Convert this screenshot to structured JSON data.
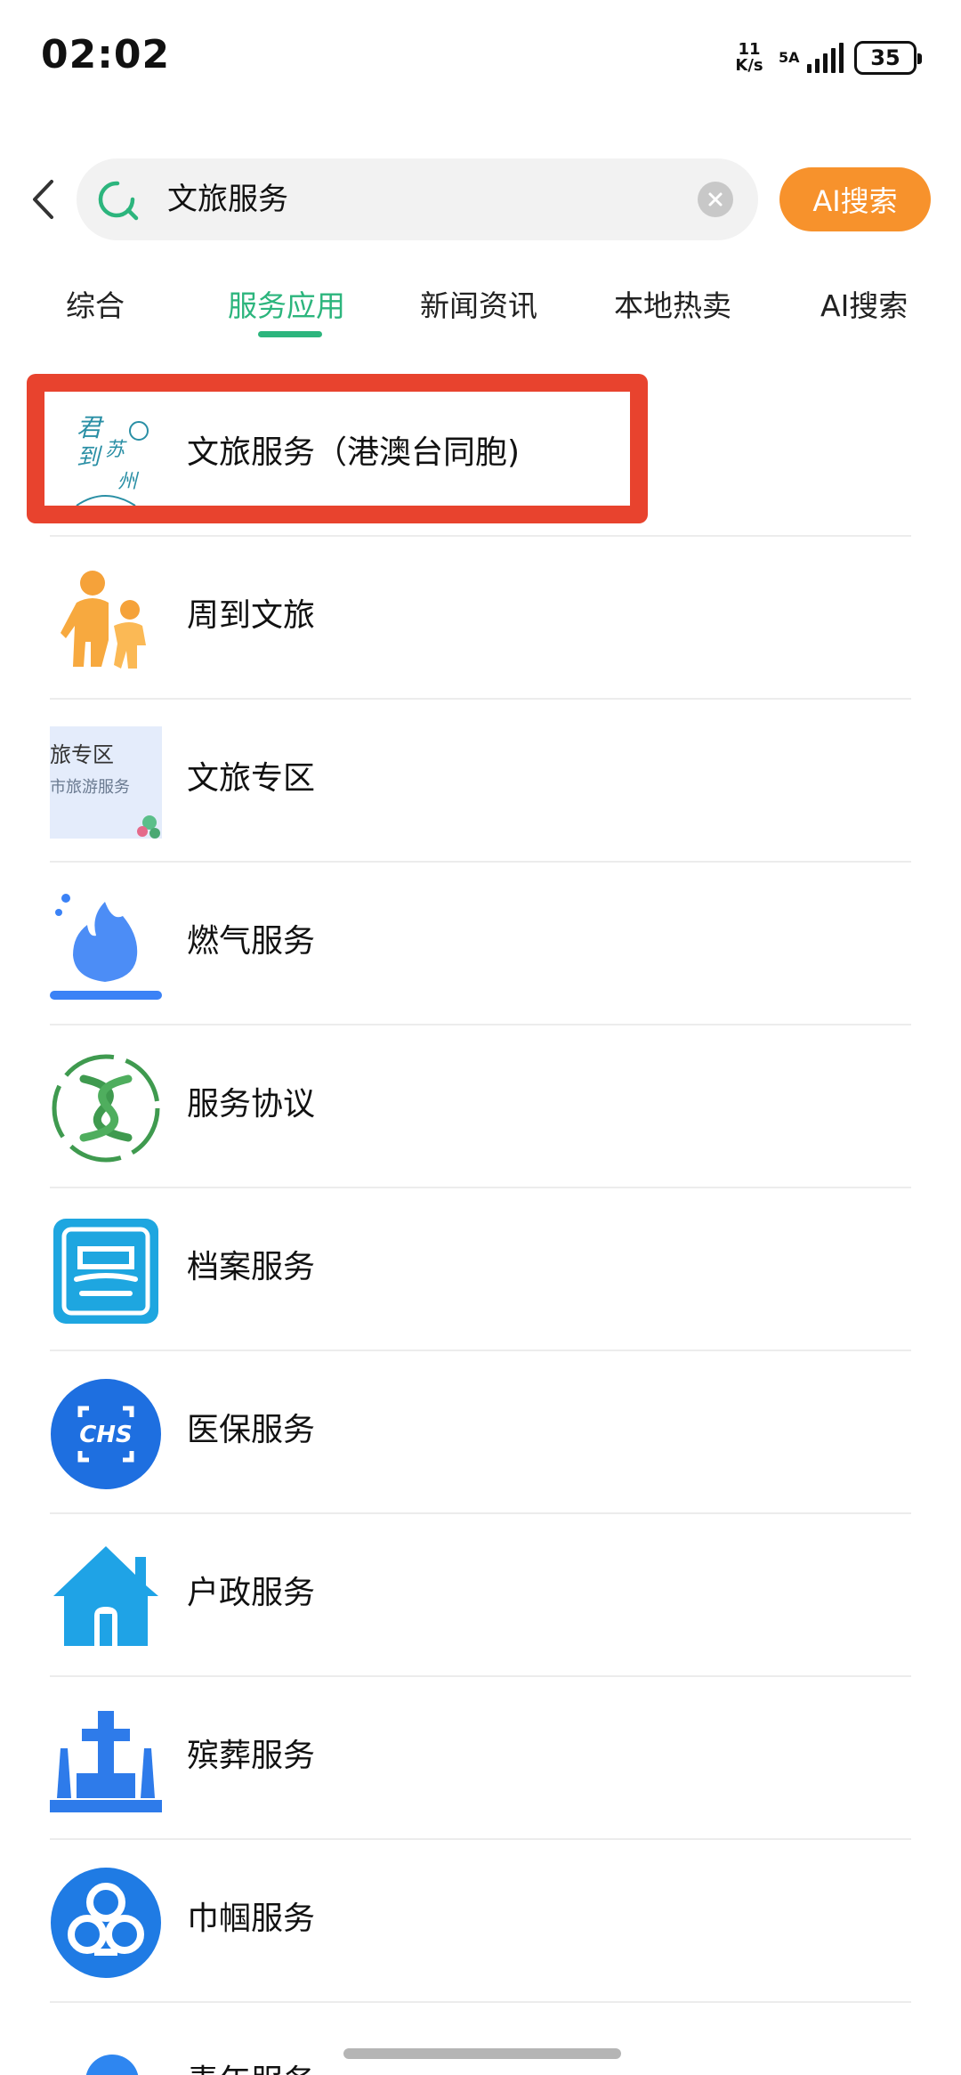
{
  "status_bar": {
    "time": "02:02",
    "net_speed_value": "11",
    "net_speed_unit": "K/s",
    "signal_label": "5A",
    "battery": "35"
  },
  "search": {
    "query": "文旅服务",
    "ai_button": "AI搜索"
  },
  "tabs": [
    {
      "label": "综合"
    },
    {
      "label": "服务应用",
      "active": true
    },
    {
      "label": "新闻资讯"
    },
    {
      "label": "本地热卖"
    },
    {
      "label": "AI搜索"
    }
  ],
  "results": [
    {
      "label": "文旅服务（港澳台同胞)",
      "icon": "calligraphy-logo-icon",
      "thumb_text": [
        "君",
        "到",
        "苏",
        "州"
      ]
    },
    {
      "label": "周到文旅",
      "icon": "parent-child-icon"
    },
    {
      "label": "文旅专区",
      "icon": "tourism-banner-icon",
      "thumb_text": [
        "旅专区",
        "市旅游服务"
      ]
    },
    {
      "label": "燃气服务",
      "icon": "gas-flame-icon"
    },
    {
      "label": "服务协议",
      "icon": "agreement-emblem-icon"
    },
    {
      "label": "档案服务",
      "icon": "archive-seal-icon"
    },
    {
      "label": "医保服务",
      "icon": "chs-medical-insurance-icon",
      "thumb_text": [
        "CHS"
      ]
    },
    {
      "label": "户政服务",
      "icon": "house-icon"
    },
    {
      "label": "殡葬服务",
      "icon": "cemetery-icon"
    },
    {
      "label": "巾帼服务",
      "icon": "women-federation-icon"
    },
    {
      "label": "青年服务",
      "icon": "cloud-icon"
    }
  ],
  "colors": {
    "accent_green": "#2cb57d",
    "ai_orange": "#f7922c",
    "highlight_red": "#e8432e",
    "icon_blue": "#2e86f0"
  }
}
